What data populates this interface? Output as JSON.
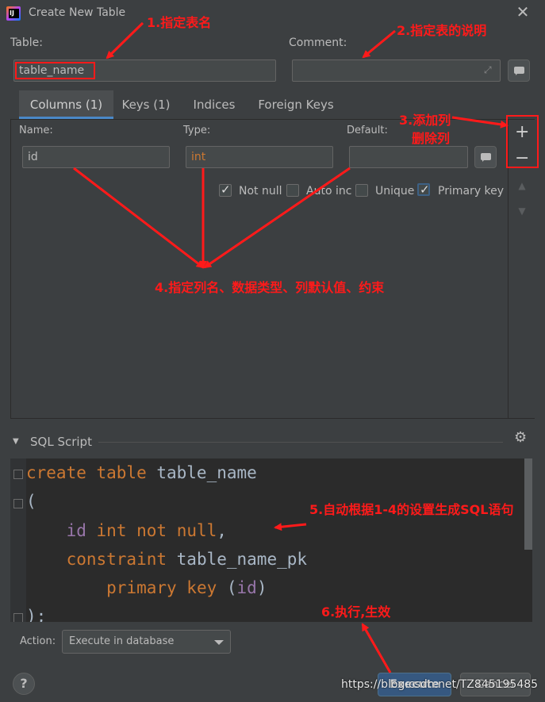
{
  "window": {
    "title": "Create New Table",
    "close": "✕"
  },
  "table": {
    "label": "Table:",
    "value": "table_name"
  },
  "comment": {
    "label": "Comment:",
    "value": ""
  },
  "tabs": [
    {
      "label": "Columns (1)",
      "active": true
    },
    {
      "label": "Keys (1)",
      "active": false
    },
    {
      "label": "Indices",
      "active": false
    },
    {
      "label": "Foreign Keys",
      "active": false
    }
  ],
  "column": {
    "name_label": "Name:",
    "name_value": "id",
    "type_label": "Type:",
    "type_value": "int",
    "default_label": "Default:",
    "default_value": ""
  },
  "checkboxes": [
    {
      "label": "Not null",
      "checked": true
    },
    {
      "label": "Auto inc",
      "checked": false
    },
    {
      "label": "Unique",
      "checked": false
    },
    {
      "label": "Primary key",
      "checked": true
    }
  ],
  "side_tools": {
    "add": "+",
    "remove": "−",
    "up": "▲",
    "down": "▼"
  },
  "sql": {
    "header": "SQL Script",
    "lines": {
      "l1_kw": "create table",
      "l1_rest": " table_name",
      "l2": "(",
      "l3_fld": "id",
      "l3_kw1": "int",
      "l3_kw2": "not null",
      "l3_rest": ",",
      "l4_kw": "constraint",
      "l4_rest": " table_name_pk",
      "l5_kw": "primary key",
      "l5_p1": " (",
      "l5_fld": "id",
      "l5_p2": ")",
      "l6": ");"
    }
  },
  "action": {
    "label": "Action:",
    "value": "Execute in database"
  },
  "buttons": {
    "help": "?",
    "execute": "Execute",
    "cancel": "Cancel"
  },
  "watermark": "https://blog.csdn.net/TZ845195485",
  "annotations": {
    "a1": "1.指定表名",
    "a2": "2.指定表的说明",
    "a3_1": "3.添加列",
    "a3_2": "删除列",
    "a4": "4.指定列名、数据类型、列默认值、约束",
    "a5": "5.自动根据1-4的设置生成SQL语句",
    "a6": "6.执行,生效"
  },
  "colors": {
    "annotation": "#ff1a1a",
    "keyword": "#cc7832",
    "field": "#9876aa",
    "accent": "#4a88c7"
  }
}
